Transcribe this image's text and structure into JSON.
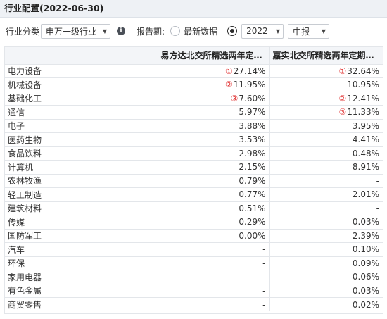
{
  "header": {
    "title": "行业配置(2022-06-30)"
  },
  "toolbar": {
    "industry_label": "行业分类",
    "industry_value": "申万一级行业",
    "report_label": "报告期:",
    "latest_label": "最新数据",
    "year_value": "2022",
    "report_value": "中报"
  },
  "table": {
    "columns": [
      "",
      "易方达北交所精选两年定开...",
      "嘉实北交所精选两年定期混..."
    ],
    "rows": [
      {
        "name": "电力设备",
        "a": "27.14%",
        "a_rank": "①",
        "b": "32.64%",
        "b_rank": "①"
      },
      {
        "name": "机械设备",
        "a": "11.95%",
        "a_rank": "②",
        "b": "10.95%",
        "b_rank": ""
      },
      {
        "name": "基础化工",
        "a": "7.60%",
        "a_rank": "③",
        "b": "12.41%",
        "b_rank": "②"
      },
      {
        "name": "通信",
        "a": "5.97%",
        "a_rank": "",
        "b": "11.33%",
        "b_rank": "③"
      },
      {
        "name": "电子",
        "a": "3.88%",
        "a_rank": "",
        "b": "3.95%",
        "b_rank": ""
      },
      {
        "name": "医药生物",
        "a": "3.53%",
        "a_rank": "",
        "b": "4.41%",
        "b_rank": ""
      },
      {
        "name": "食品饮料",
        "a": "2.98%",
        "a_rank": "",
        "b": "0.48%",
        "b_rank": ""
      },
      {
        "name": "计算机",
        "a": "2.15%",
        "a_rank": "",
        "b": "8.91%",
        "b_rank": ""
      },
      {
        "name": "农林牧渔",
        "a": "0.79%",
        "a_rank": "",
        "b": "-",
        "b_rank": ""
      },
      {
        "name": "轻工制造",
        "a": "0.77%",
        "a_rank": "",
        "b": "2.01%",
        "b_rank": ""
      },
      {
        "name": "建筑材料",
        "a": "0.51%",
        "a_rank": "",
        "b": "-",
        "b_rank": ""
      },
      {
        "name": "传媒",
        "a": "0.29%",
        "a_rank": "",
        "b": "0.03%",
        "b_rank": ""
      },
      {
        "name": "国防军工",
        "a": "0.00%",
        "a_rank": "",
        "b": "2.39%",
        "b_rank": ""
      },
      {
        "name": "汽车",
        "a": "-",
        "a_rank": "",
        "b": "0.10%",
        "b_rank": ""
      },
      {
        "name": "环保",
        "a": "-",
        "a_rank": "",
        "b": "0.09%",
        "b_rank": ""
      },
      {
        "name": "家用电器",
        "a": "-",
        "a_rank": "",
        "b": "0.06%",
        "b_rank": ""
      },
      {
        "name": "有色金属",
        "a": "-",
        "a_rank": "",
        "b": "0.03%",
        "b_rank": ""
      },
      {
        "name": "商贸零售",
        "a": "-",
        "a_rank": "",
        "b": "0.02%",
        "b_rank": ""
      }
    ]
  }
}
